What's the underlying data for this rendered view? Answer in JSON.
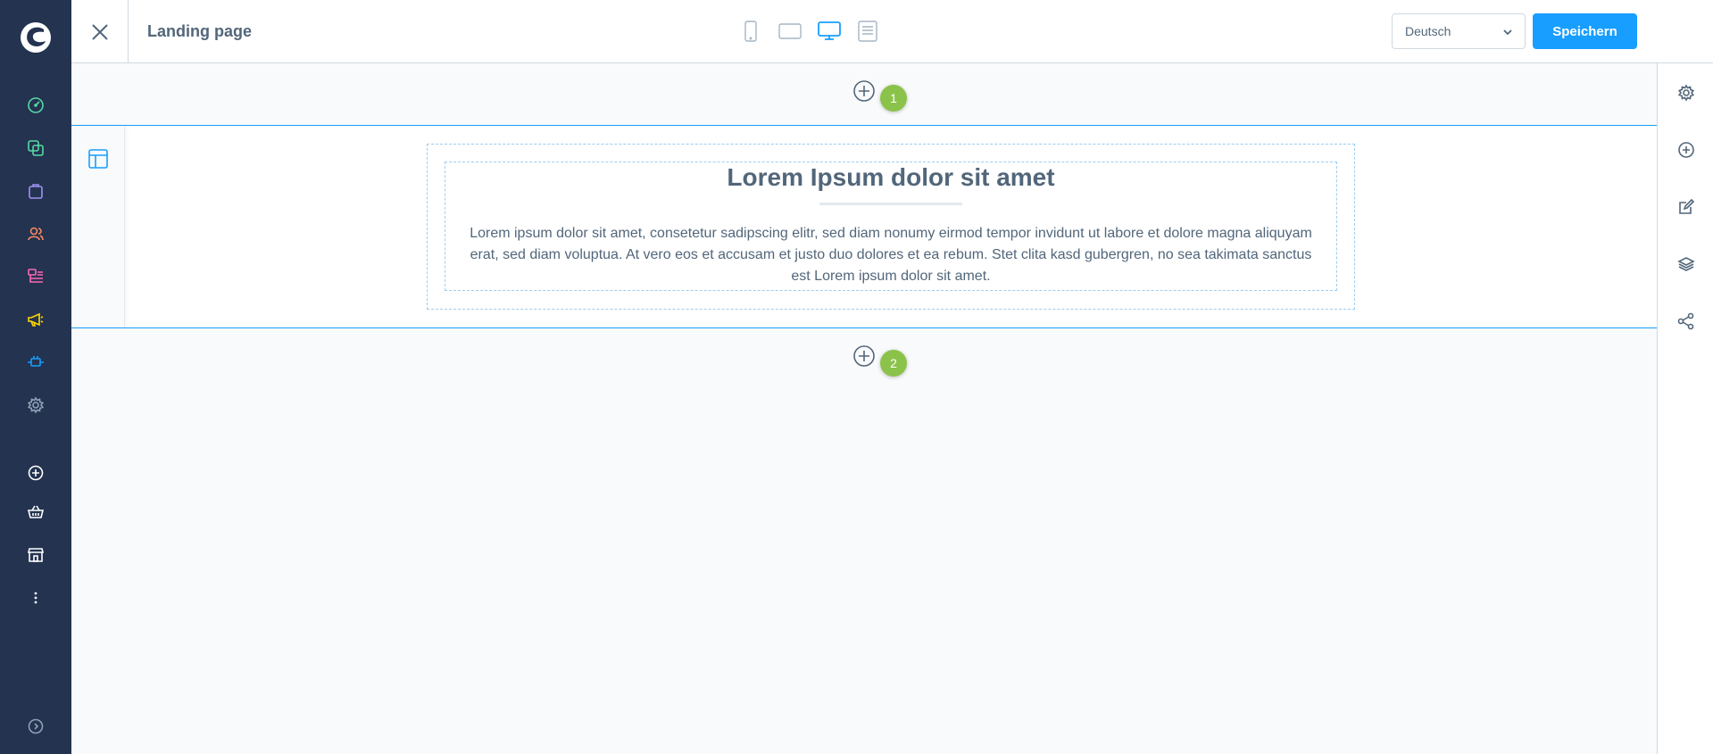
{
  "header": {
    "title": "Landing page",
    "language": "Deutsch",
    "save_label": "Speichern"
  },
  "canvas": {
    "heading": "Lorem Ipsum dolor sit amet",
    "text": "Lorem ipsum dolor sit amet, consetetur sadipscing elitr, sed diam nonumy eirmod tempor invidunt ut labore et dolore magna aliquyam erat, sed diam voluptua. At vero eos et accusam et justo duo dolores et ea rebum. Stet clita kasd gubergren, no sea takimata sanctus est Lorem ipsum dolor sit amet.",
    "badge_top": "1",
    "badge_bottom": "2"
  },
  "colors": {
    "nav_bg": "#233350",
    "accent": "#189eff",
    "badge": "#8bc34a"
  },
  "icons": {
    "nav": [
      "dashboard-icon",
      "catalogue-icon",
      "orders-icon",
      "customers-icon",
      "content-icon",
      "marketing-icon",
      "extensions-icon",
      "settings-icon",
      "add-icon",
      "basket-icon",
      "storefront-icon",
      "more-icon",
      "expand-icon"
    ],
    "right_sidebar": [
      "gear-icon",
      "add-circle-icon",
      "edit-icon",
      "layers-icon",
      "share-icon"
    ],
    "devices": [
      "mobile-icon",
      "tablet-icon",
      "desktop-icon",
      "form-icon"
    ]
  }
}
